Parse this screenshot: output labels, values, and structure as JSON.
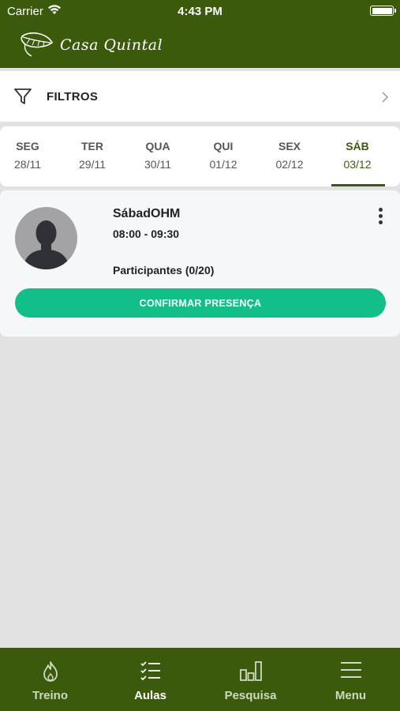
{
  "status_bar": {
    "carrier": "Carrier",
    "time": "4:43 PM"
  },
  "header": {
    "logo_text": "Casa Quintal"
  },
  "filters": {
    "label": "FILTROS"
  },
  "days": [
    {
      "name": "SEG",
      "date": "28/11"
    },
    {
      "name": "TER",
      "date": "29/11"
    },
    {
      "name": "QUA",
      "date": "30/11"
    },
    {
      "name": "QUI",
      "date": "01/12"
    },
    {
      "name": "SEX",
      "date": "02/12"
    },
    {
      "name": "SÁB",
      "date": "03/12"
    }
  ],
  "selected_day": "SÁB",
  "class_card": {
    "title": "SábadOHM",
    "time": "08:00 - 09:30",
    "participants": "Participantes (0/20)",
    "confirm_label": "CONFIRMAR PRESENÇA"
  },
  "tabbar": {
    "tabs": [
      {
        "label": "Treino",
        "icon": "flame-icon"
      },
      {
        "label": "Aulas",
        "icon": "checklist-icon"
      },
      {
        "label": "Pesquisa",
        "icon": "bar-chart-icon"
      },
      {
        "label": "Menu",
        "icon": "hamburger-menu-icon"
      }
    ],
    "active": "Aulas"
  },
  "colors": {
    "brand_green": "#3b5a0c",
    "confirm_button": "#12bf88",
    "background": "#e2e2e2"
  }
}
